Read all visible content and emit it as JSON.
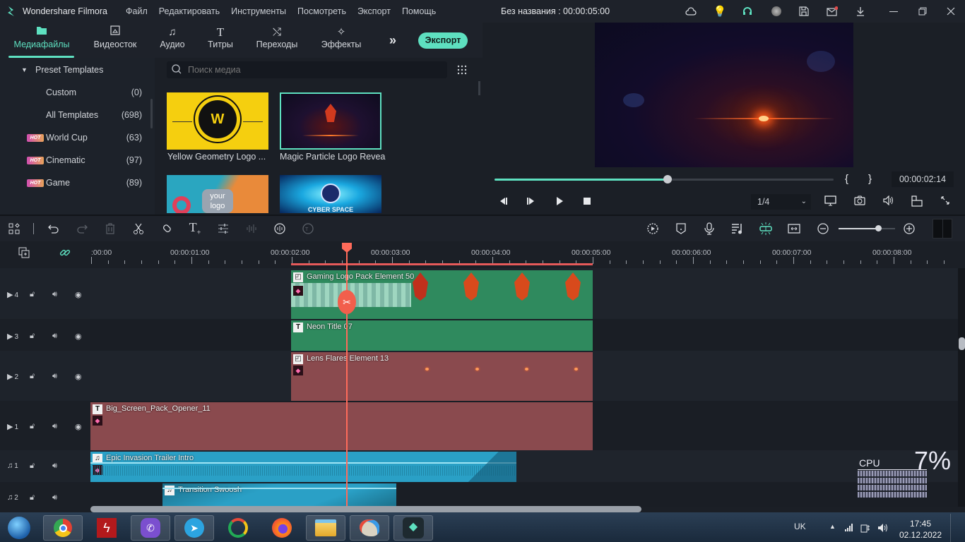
{
  "app": {
    "name": "Wondershare Filmora",
    "menu": [
      "Файл",
      "Редактировать",
      "Инструменты",
      "Посмотреть",
      "Экспорт",
      "Помощь"
    ],
    "project_title": "Без названия : 00:00:05:00",
    "title_icons": [
      "cloud-icon",
      "lightbulb-icon",
      "headset-icon",
      "avatar-icon",
      "save-icon",
      "mail-icon",
      "download-icon"
    ],
    "window_controls": [
      "minimize",
      "restore",
      "close"
    ]
  },
  "tabs": {
    "items": [
      {
        "label": "Медиафайлы",
        "icon": "folder-icon",
        "active": true
      },
      {
        "label": "Видеосток",
        "icon": "stock-icon",
        "active": false
      },
      {
        "label": "Аудио",
        "icon": "music-icon",
        "active": false
      },
      {
        "label": "Титры",
        "icon": "title-icon",
        "active": false
      },
      {
        "label": "Переходы",
        "icon": "transition-icon",
        "active": false
      },
      {
        "label": "Эффекты",
        "icon": "effects-icon",
        "active": false
      }
    ],
    "export_label": "Экспорт",
    "more": "»"
  },
  "sidebar": {
    "group": "Preset Templates",
    "items": [
      {
        "label": "Custom",
        "count": "(0)",
        "hot": false
      },
      {
        "label": "All Templates",
        "count": "(698)",
        "hot": false
      },
      {
        "label": "World Cup",
        "count": "(63)",
        "hot": true
      },
      {
        "label": "Cinematic",
        "count": "(97)",
        "hot": true
      },
      {
        "label": "Game",
        "count": "(89)",
        "hot": true
      }
    ],
    "hot_badge": "HOT"
  },
  "media": {
    "search_placeholder": "Поиск медиа",
    "items": [
      {
        "title": "Yellow Geometry Logo ...",
        "selected": false
      },
      {
        "title": "Magic Particle Logo Reveal",
        "selected": true
      },
      {
        "title": "",
        "thumb_text": "your logo",
        "selected": false
      },
      {
        "title": "",
        "thumb_text": "CYBER SPACE",
        "selected": false
      }
    ],
    "thumb_w_text": "W"
  },
  "preview": {
    "timecode": "00:00:02:14",
    "progress": 0.51,
    "mark_in": "{",
    "mark_out": "}",
    "quality": "1/4"
  },
  "timeline": {
    "zoom_level": 0.7,
    "ruler_labels": [
      ":00:00",
      "00:00:01:00",
      "00:00:02:00",
      "00:00:03:00",
      "00:00:04:00",
      "00:00:05:00",
      "00:00:06:00",
      "00:00:07:00",
      "00:00:08:00"
    ],
    "playhead_time": "00:00:02:14",
    "tracks": [
      {
        "type": "video",
        "num": "4",
        "clips": [
          {
            "name": "Gaming Logo Pack Element 50",
            "kind": "element",
            "color": "#2f8a5e"
          }
        ]
      },
      {
        "type": "video",
        "num": "3",
        "clips": [
          {
            "name": "Neon Title 07",
            "kind": "title",
            "color": "#2f8a5e"
          }
        ]
      },
      {
        "type": "video",
        "num": "2",
        "clips": [
          {
            "name": "Lens Flares Element 13",
            "kind": "element",
            "color": "#8a4a4e"
          }
        ]
      },
      {
        "type": "video",
        "num": "1",
        "clips": [
          {
            "name": "Big_Screen_Pack_Opener_11",
            "kind": "title",
            "color": "#8a4a4e"
          }
        ]
      },
      {
        "type": "audio",
        "num": "1",
        "clips": [
          {
            "name": "Epic Invasion Trailer Intro",
            "kind": "audio",
            "color": "#2aa0c6"
          }
        ]
      },
      {
        "type": "audio",
        "num": "2",
        "clips": [
          {
            "name": "Transition Swoosh",
            "kind": "audio",
            "color": "#2aa0c6"
          }
        ]
      }
    ]
  },
  "cpu": {
    "label": "CPU",
    "value": "7%"
  },
  "taskbar": {
    "apps": [
      "start",
      "chrome",
      "flash",
      "viber",
      "telegram",
      "speedometer",
      "firefox",
      "file-explorer",
      "paint",
      "filmora"
    ],
    "lang": "UK",
    "time": "17:45",
    "date": "02.12.2022"
  }
}
